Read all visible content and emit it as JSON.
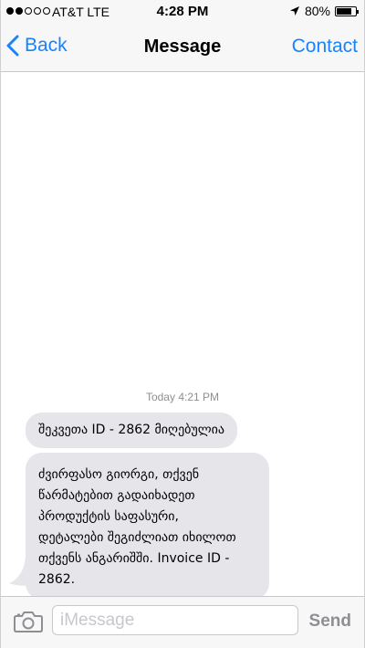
{
  "status_bar": {
    "signal_bars_filled": 2,
    "signal_bars_total": 5,
    "carrier": "AT&T LTE",
    "time": "4:28 PM",
    "location_icon": "location-arrow-icon",
    "battery_percent": "80%",
    "battery_level": 0.8
  },
  "nav": {
    "back_label": "Back",
    "title": "Message",
    "contact_label": "Contact"
  },
  "conversation": {
    "timestamp_day": "Today",
    "timestamp_time": "4:21 PM",
    "messages": [
      {
        "text": "შეკვეთა ID - 2862 მიღებულია"
      },
      {
        "text": "ძვირფასო გიორგი, თქვენ\nწარმატებით გადაიხადეთ\nპროდუქტის საფასური,\nდეტალები შეგიძლიათ იხილოთ\nთქვენს ანგარიშში. Invoice ID -\n2862."
      }
    ]
  },
  "input_bar": {
    "camera_icon": "camera-icon",
    "placeholder": "iMessage",
    "value": "",
    "send_label": "Send"
  },
  "colors": {
    "ios_blue": "#1a82fb",
    "bubble_gray": "#e5e5ea",
    "send_disabled": "#8e8e93"
  }
}
